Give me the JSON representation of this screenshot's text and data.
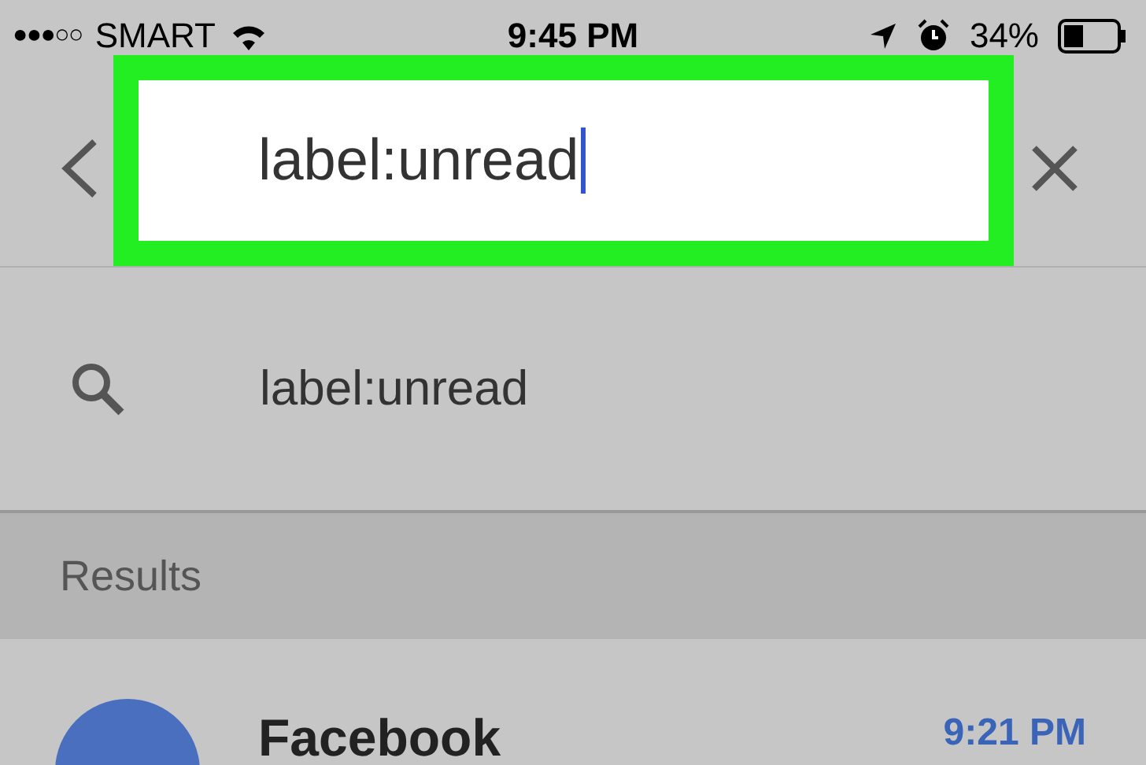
{
  "status_bar": {
    "signal": "●●●○○",
    "carrier": "SMART",
    "time": "9:45 PM",
    "battery": "34%"
  },
  "search": {
    "value": "label:unread",
    "highlighted": true
  },
  "suggestions": [
    {
      "text": "label:unread"
    }
  ],
  "results_header": "Results",
  "results": [
    {
      "sender": "Facebook",
      "time": "9:21 PM"
    }
  ]
}
